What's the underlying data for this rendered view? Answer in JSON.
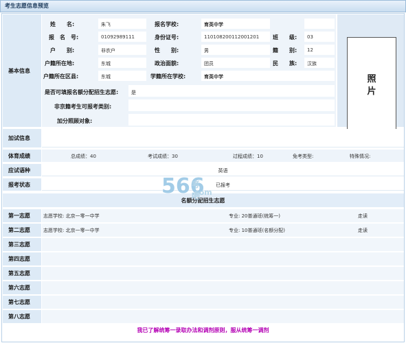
{
  "window": {
    "title": "考生志愿信息预览"
  },
  "basic": {
    "section_label": "基本信息",
    "name_label": "姓　　名:",
    "name_value": "朱飞",
    "school_label": "报名学校:",
    "school_value": "育英中学",
    "regno_label": "报　名　号:",
    "regno_value": "01092989111",
    "idno_label": "身份证号:",
    "idno_value": "110108200112001201",
    "class_label": "班　　级:",
    "class_value": "03",
    "hukou_type_label": "户　　别:",
    "hukou_type_value": "非农户",
    "gender_label": "性　　别:",
    "gender_value": "男",
    "age_label": "籍　　别:",
    "age_value": "12",
    "hukou_loc_label": "户籍所在地:",
    "hukou_loc_value": "东城",
    "political_label": "政治面貌:",
    "political_value": "团员",
    "ethnic_label": "民　　族:",
    "ethnic_value": "汉族",
    "district_label": "户籍所在区县:",
    "district_value": "东城",
    "school_district_label": "学籍所在学校:",
    "school_district_value": "育英中学",
    "quota_label": "是否可填报名额分配招生志愿:",
    "quota_value": "是",
    "nonbj_label": "非京籍考生可报考类别:",
    "nonbj_value": "",
    "bonus_label": "加分照顾对象:",
    "bonus_value": "",
    "photo_label_1": "照",
    "photo_label_2": "片"
  },
  "extra_exam": {
    "label": "加试信息",
    "value": ""
  },
  "pe": {
    "label": "体育成绩",
    "total": "总成绩：40",
    "exam": "考试成绩：30",
    "process": "过程成绩：10",
    "exempt": "免考类型:",
    "special": "特殊情况:"
  },
  "language": {
    "label": "应试语种",
    "value": "英语"
  },
  "status": {
    "label": "报考状态",
    "value": "已报考"
  },
  "quota_section": {
    "title": "名额分配招生志愿"
  },
  "choices": [
    {
      "label": "第一志愿",
      "school": "志愿学校: 北京一零一中学",
      "major": "专业: 20普通班(统筹一)",
      "mode": "走读"
    },
    {
      "label": "第二志愿",
      "school": "志愿学校: 北京一零一中学",
      "major": "专业: 10普通班(名额分配)",
      "mode": "走读"
    },
    {
      "label": "第三志愿",
      "school": "",
      "major": "",
      "mode": ""
    },
    {
      "label": "第四志愿",
      "school": "",
      "major": "",
      "mode": ""
    },
    {
      "label": "第五志愿",
      "school": "",
      "major": "",
      "mode": ""
    },
    {
      "label": "第六志愿",
      "school": "",
      "major": "",
      "mode": ""
    },
    {
      "label": "第七志愿",
      "school": "",
      "major": "",
      "mode": ""
    },
    {
      "label": "第八志愿",
      "school": "",
      "major": "",
      "mode": ""
    }
  ],
  "notice": "我已了解统筹一录取办法和调剂原则，服从统筹一调剂",
  "watermark": {
    "number": "566",
    "text": "考吧",
    "domain": ".com"
  }
}
